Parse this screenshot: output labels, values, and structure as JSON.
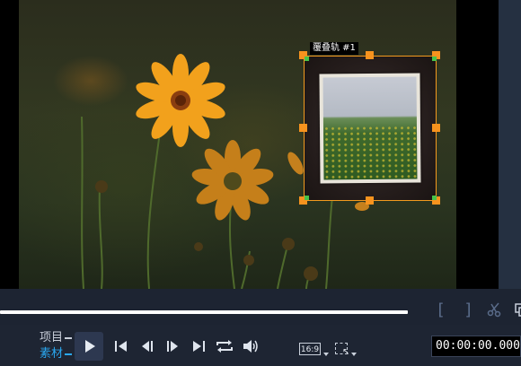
{
  "preview": {
    "overlay_label": "覆叠轨 #1"
  },
  "trim_toolbar": {
    "mark_in": "[",
    "mark_out": "]",
    "split_icon": "scissors-icon",
    "copy_icon": "copy-icon"
  },
  "transport": {
    "mode_project": "项目",
    "mode_clip": "素材",
    "buttons": [
      "play-icon",
      "skip-to-start-icon",
      "previous-frame-icon",
      "next-frame-icon",
      "skip-to-end-icon",
      "repeat-icon",
      "volume-icon"
    ],
    "aspect_ratio": "16:9",
    "timecode": "00:00:00.000"
  },
  "colors": {
    "accent_selected": "#2aa7ef",
    "handle": "#f7931e",
    "corner_handle": "#49c34a",
    "panel_bg": "#1e2533"
  }
}
